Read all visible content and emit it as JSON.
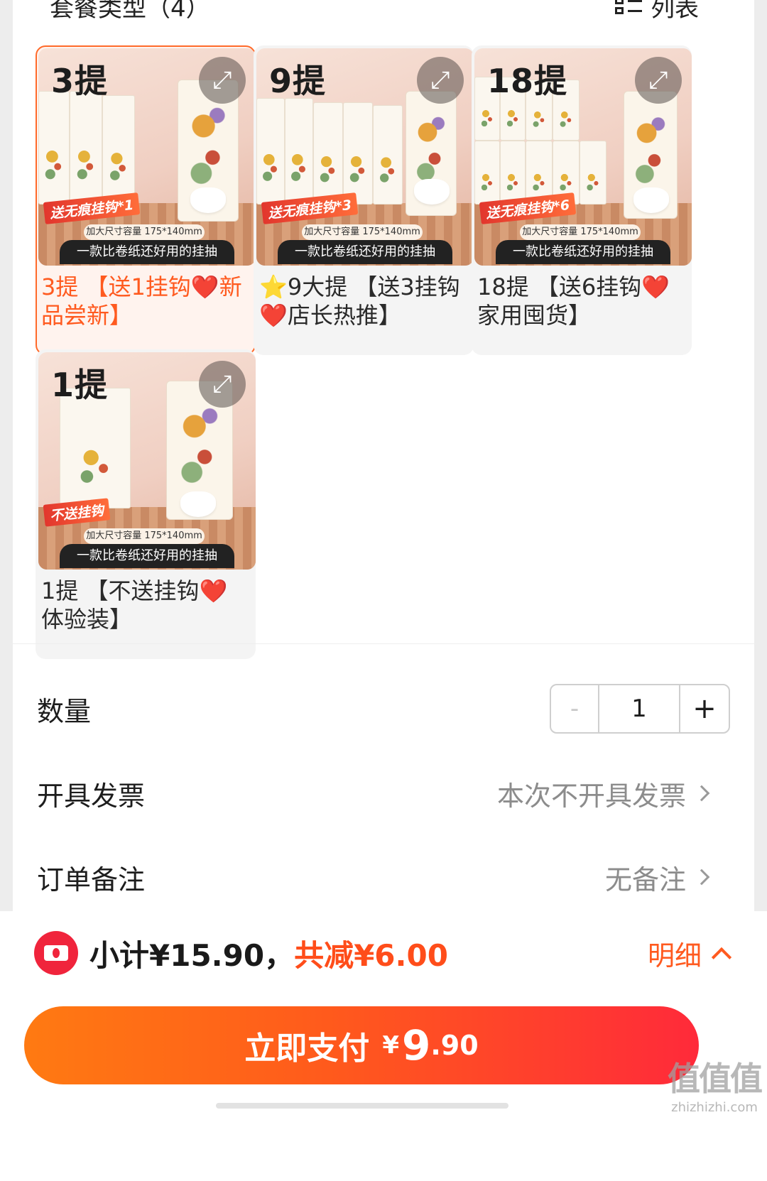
{
  "section": {
    "title": "套餐类型（4）",
    "view_toggle_label": "列表"
  },
  "packages": [
    {
      "count_label": "3提",
      "gift_tag": "送无痕挂钩*1",
      "size_tag": "加大尺寸容量 175*140mm",
      "slogan": "一款比卷纸还好用的挂抽",
      "name": "3提 【送1挂钩❤️新品尝新】",
      "selected": true
    },
    {
      "count_label": "9提",
      "gift_tag": "送无痕挂钩*3",
      "size_tag": "加大尺寸容量 175*140mm",
      "slogan": "一款比卷纸还好用的挂抽",
      "name": "⭐9大提 【送3挂钩❤️店长热推】",
      "selected": false
    },
    {
      "count_label": "18提",
      "gift_tag": "送无痕挂钩*6",
      "size_tag": "加大尺寸容量 175*140mm",
      "slogan": "一款比卷纸还好用的挂抽",
      "name": "18提 【送6挂钩❤️家用囤货】",
      "selected": false
    },
    {
      "count_label": "1提",
      "gift_tag": "不送挂钩",
      "size_tag": "加大尺寸容量 175*140mm",
      "slogan": "一款比卷纸还好用的挂抽",
      "name": "1提 【不送挂钩❤️体验装】",
      "selected": false
    }
  ],
  "quantity": {
    "label": "数量",
    "minus": "-",
    "value": "1",
    "plus": "+"
  },
  "invoice": {
    "label": "开具发票",
    "value": "本次不开具发票"
  },
  "remark": {
    "label": "订单备注",
    "value": "无备注"
  },
  "summary": {
    "subtotal": "小计¥15.90，",
    "discount": "共减¥6.00",
    "detail_label": "明细"
  },
  "pay": {
    "label": "立即支付",
    "currency": "¥",
    "amount_int": "9",
    "amount_dec": ".90"
  },
  "watermark": {
    "big": "值值值",
    "small": "zhizhizhi.com"
  },
  "icons": {
    "expand": "expand-icon",
    "list": "list-view-icon",
    "coupon": "coupon-icon",
    "chevron": "chevron-right-icon",
    "chevron_up": "chevron-up-icon"
  },
  "colors": {
    "accent": "#ff5a1f",
    "discount": "#ff4d1a",
    "coupon": "#f0243c",
    "pay_start": "#ff7a12",
    "pay_end": "#ff2a3a"
  }
}
